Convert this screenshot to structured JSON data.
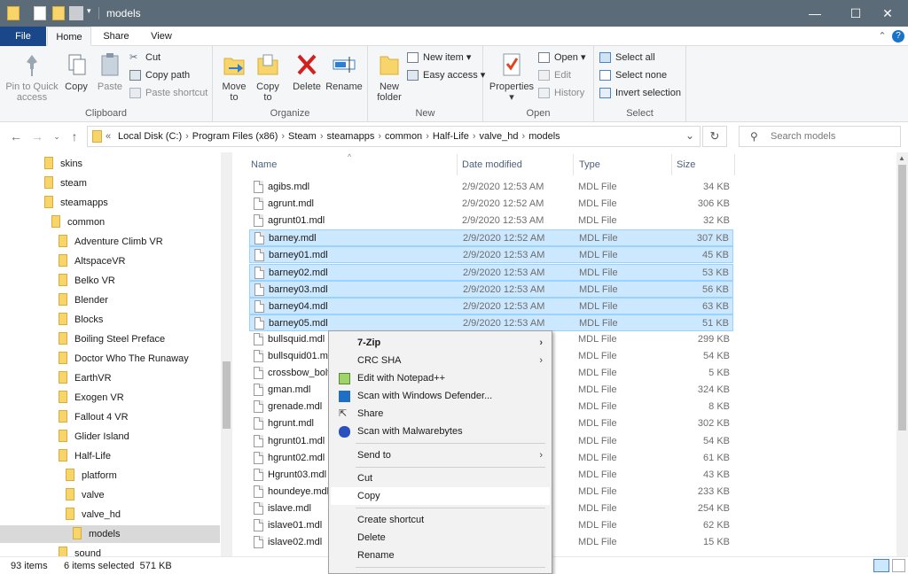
{
  "window": {
    "title": "models",
    "minimize": "—",
    "maximize": "☐",
    "close": "✕"
  },
  "tabs": {
    "file": "File",
    "home": "Home",
    "share": "Share",
    "view": "View",
    "collapse": "⌃",
    "help": "?"
  },
  "ribbon": {
    "clipboard": {
      "label": "Clipboard",
      "pin": "Pin to Quick access",
      "copy": "Copy",
      "paste": "Paste",
      "cut": "Cut",
      "copy_path": "Copy path",
      "paste_shortcut": "Paste shortcut"
    },
    "organize": {
      "label": "Organize",
      "move_to": "Move to",
      "copy_to": "Copy to",
      "delete": "Delete",
      "rename": "Rename"
    },
    "new": {
      "label": "New",
      "new_folder": "New folder",
      "new_item": "New item",
      "easy_access": "Easy access"
    },
    "open": {
      "label": "Open",
      "properties": "Properties",
      "open": "Open",
      "edit": "Edit",
      "history": "History"
    },
    "select": {
      "label": "Select",
      "select_all": "Select all",
      "select_none": "Select none",
      "invert": "Invert selection"
    }
  },
  "address": {
    "crumbs": [
      "Local Disk (C:)",
      "Program Files (x86)",
      "Steam",
      "steamapps",
      "common",
      "Half-Life",
      "valve_hd",
      "models"
    ],
    "sep": "›",
    "lead": "«"
  },
  "search": {
    "placeholder": "Search models"
  },
  "nav": [
    "skins",
    "steam",
    "steamapps",
    "common",
    "Adventure Climb VR",
    "AltspaceVR",
    "Belko VR",
    "Blender",
    "Blocks",
    "Boiling Steel Preface",
    "Doctor Who The Runaway",
    "EarthVR",
    "Exogen VR",
    "Fallout 4 VR",
    "Glider Island",
    "Half-Life",
    "platform",
    "valve",
    "valve_hd",
    "models",
    "sound"
  ],
  "columns": {
    "name": "Name",
    "date": "Date modified",
    "type": "Type",
    "size": "Size"
  },
  "files": [
    {
      "name": "agibs.mdl",
      "date": "2/9/2020 12:53 AM",
      "type": "MDL File",
      "size": "34 KB"
    },
    {
      "name": "agrunt.mdl",
      "date": "2/9/2020 12:52 AM",
      "type": "MDL File",
      "size": "306 KB"
    },
    {
      "name": "agrunt01.mdl",
      "date": "2/9/2020 12:53 AM",
      "type": "MDL File",
      "size": "32 KB"
    },
    {
      "name": "barney.mdl",
      "date": "2/9/2020 12:52 AM",
      "type": "MDL File",
      "size": "307 KB"
    },
    {
      "name": "barney01.mdl",
      "date": "2/9/2020 12:53 AM",
      "type": "MDL File",
      "size": "45 KB"
    },
    {
      "name": "barney02.mdl",
      "date": "2/9/2020 12:53 AM",
      "type": "MDL File",
      "size": "53 KB"
    },
    {
      "name": "barney03.mdl",
      "date": "2/9/2020 12:53 AM",
      "type": "MDL File",
      "size": "56 KB"
    },
    {
      "name": "barney04.mdl",
      "date": "2/9/2020 12:53 AM",
      "type": "MDL File",
      "size": "63 KB"
    },
    {
      "name": "barney05.mdl",
      "date": "2/9/2020 12:53 AM",
      "type": "MDL File",
      "size": "51 KB"
    },
    {
      "name": "bullsquid.mdl",
      "date": "",
      "type": "MDL File",
      "size": "299 KB"
    },
    {
      "name": "bullsquid01.m",
      "date": "",
      "type": "MDL File",
      "size": "54 KB"
    },
    {
      "name": "crossbow_bolt",
      "date": "",
      "type": "MDL File",
      "size": "5 KB"
    },
    {
      "name": "gman.mdl",
      "date": "",
      "type": "MDL File",
      "size": "324 KB"
    },
    {
      "name": "grenade.mdl",
      "date": "",
      "type": "MDL File",
      "size": "8 KB"
    },
    {
      "name": "hgrunt.mdl",
      "date": "",
      "type": "MDL File",
      "size": "302 KB"
    },
    {
      "name": "hgrunt01.mdl",
      "date": "",
      "type": "MDL File",
      "size": "54 KB"
    },
    {
      "name": "hgrunt02.mdl",
      "date": "",
      "type": "MDL File",
      "size": "61 KB"
    },
    {
      "name": "Hgrunt03.mdl",
      "date": "",
      "type": "MDL File",
      "size": "43 KB"
    },
    {
      "name": "houndeye.mdl",
      "date": "",
      "type": "MDL File",
      "size": "233 KB"
    },
    {
      "name": "islave.mdl",
      "date": "",
      "type": "MDL File",
      "size": "254 KB"
    },
    {
      "name": "islave01.mdl",
      "date": "",
      "type": "MDL File",
      "size": "62 KB"
    },
    {
      "name": "islave02.mdl",
      "date": "",
      "type": "MDL File",
      "size": "15 KB"
    }
  ],
  "context_menu": {
    "zip": "7-Zip",
    "crc": "CRC SHA",
    "notepad": "Edit with Notepad++",
    "defender": "Scan with Windows Defender...",
    "share": "Share",
    "malwarebytes": "Scan with Malwarebytes",
    "send_to": "Send to",
    "cut": "Cut",
    "copy": "Copy",
    "create_shortcut": "Create shortcut",
    "delete": "Delete",
    "rename": "Rename",
    "submenu_arrow": "›"
  },
  "status": {
    "items": "93 items",
    "selected": "6 items selected  571 KB"
  },
  "colors": {
    "titlebar": "#5b6b78",
    "file_tab": "#19478a",
    "selection": "#cce8ff",
    "folder": "#f7d56a"
  }
}
